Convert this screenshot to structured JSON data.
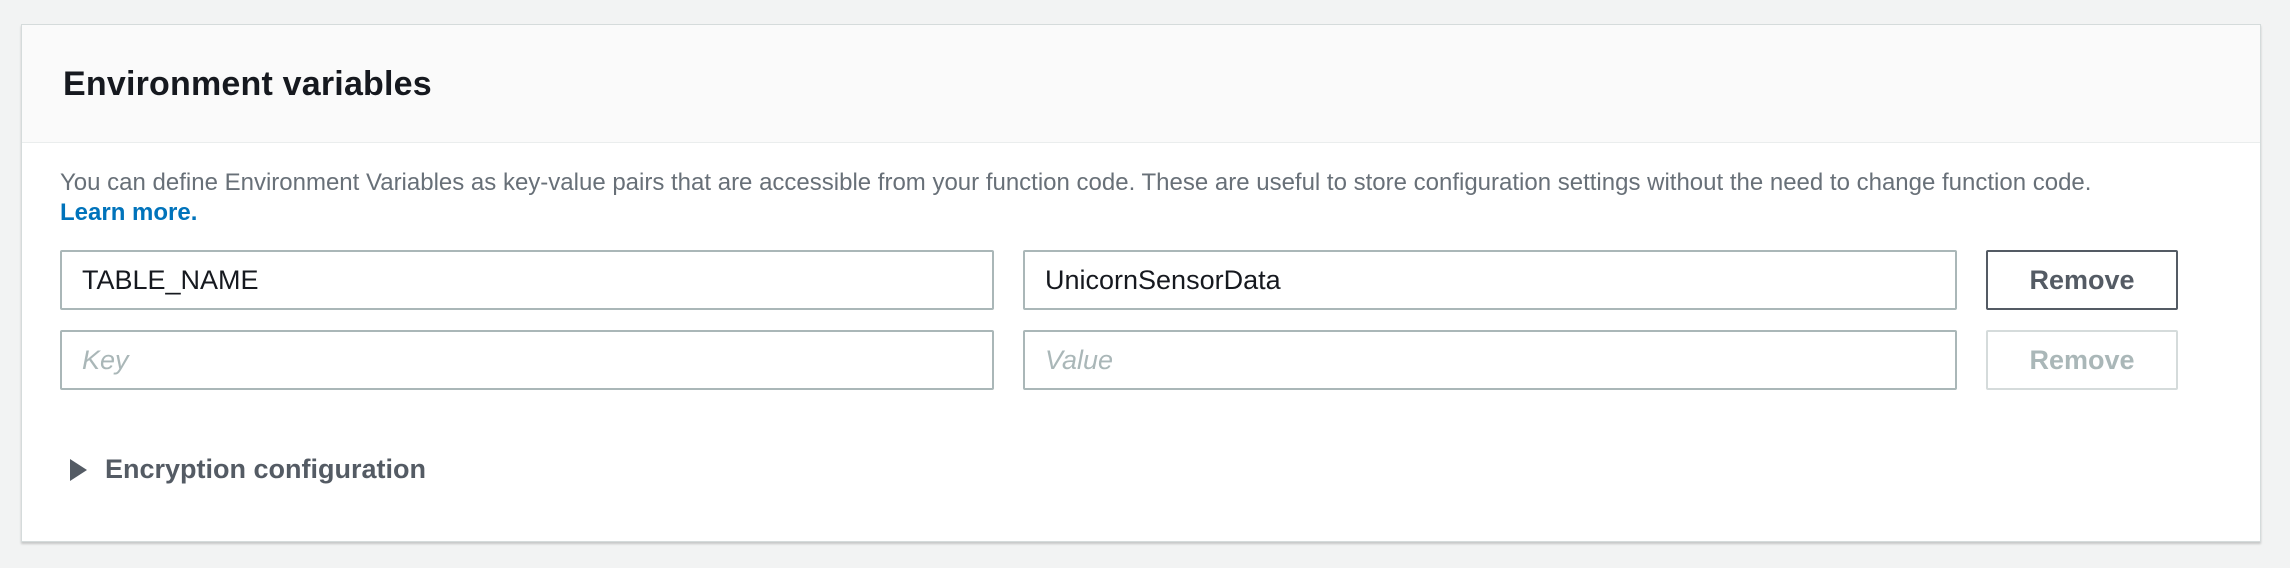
{
  "panel": {
    "title": "Environment variables"
  },
  "description": {
    "text": "You can define Environment Variables as key-value pairs that are accessible from your function code. These are useful to store configuration settings without the need to change function code.",
    "learn_more": "Learn more."
  },
  "variables": [
    {
      "key": "TABLE_NAME",
      "value": "UnicornSensorData",
      "remove_label": "Remove"
    },
    {
      "key_placeholder": "Key",
      "value_placeholder": "Value",
      "remove_label": "Remove"
    }
  ],
  "encryption": {
    "label": "Encryption configuration",
    "icon": "caret-right-icon"
  },
  "colors": {
    "link": "#0073bb",
    "text": "#16191f",
    "muted": "#687078",
    "border": "#aab7b8"
  }
}
